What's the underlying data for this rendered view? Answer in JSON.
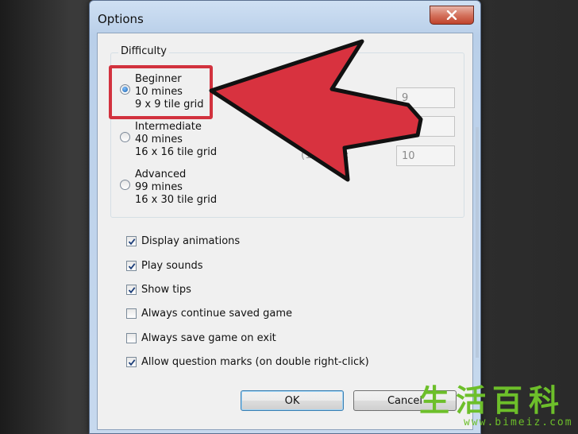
{
  "window": {
    "title": "Options"
  },
  "difficulty": {
    "legend": "Difficulty",
    "options": [
      {
        "name": "Beginner",
        "mines": "10 mines",
        "grid": "9 x 9 tile grid",
        "selected": true
      },
      {
        "name": "Intermediate",
        "mines": "40 mines",
        "grid": "16 x 16 tile grid",
        "selected": false
      },
      {
        "name": "Advanced",
        "mines": "99 mines",
        "grid": "16 x 30 tile grid",
        "selected": false
      }
    ],
    "custom": {
      "field1": "9",
      "field3": "10",
      "label3": "(10-668):"
    }
  },
  "checkboxes": [
    {
      "label": "Display animations",
      "checked": true
    },
    {
      "label": "Play sounds",
      "checked": true
    },
    {
      "label": "Show tips",
      "checked": true
    },
    {
      "label": "Always continue saved game",
      "checked": false
    },
    {
      "label": "Always save game on exit",
      "checked": false
    },
    {
      "label": "Allow question marks (on double right-click)",
      "checked": true
    }
  ],
  "buttons": {
    "ok": "OK",
    "cancel": "Cancel"
  },
  "watermark": {
    "chars": "生活百科",
    "url": "www.bimeiz.com"
  },
  "colors": {
    "highlight": "#d2323e",
    "watermark": "#6dbf2a"
  }
}
